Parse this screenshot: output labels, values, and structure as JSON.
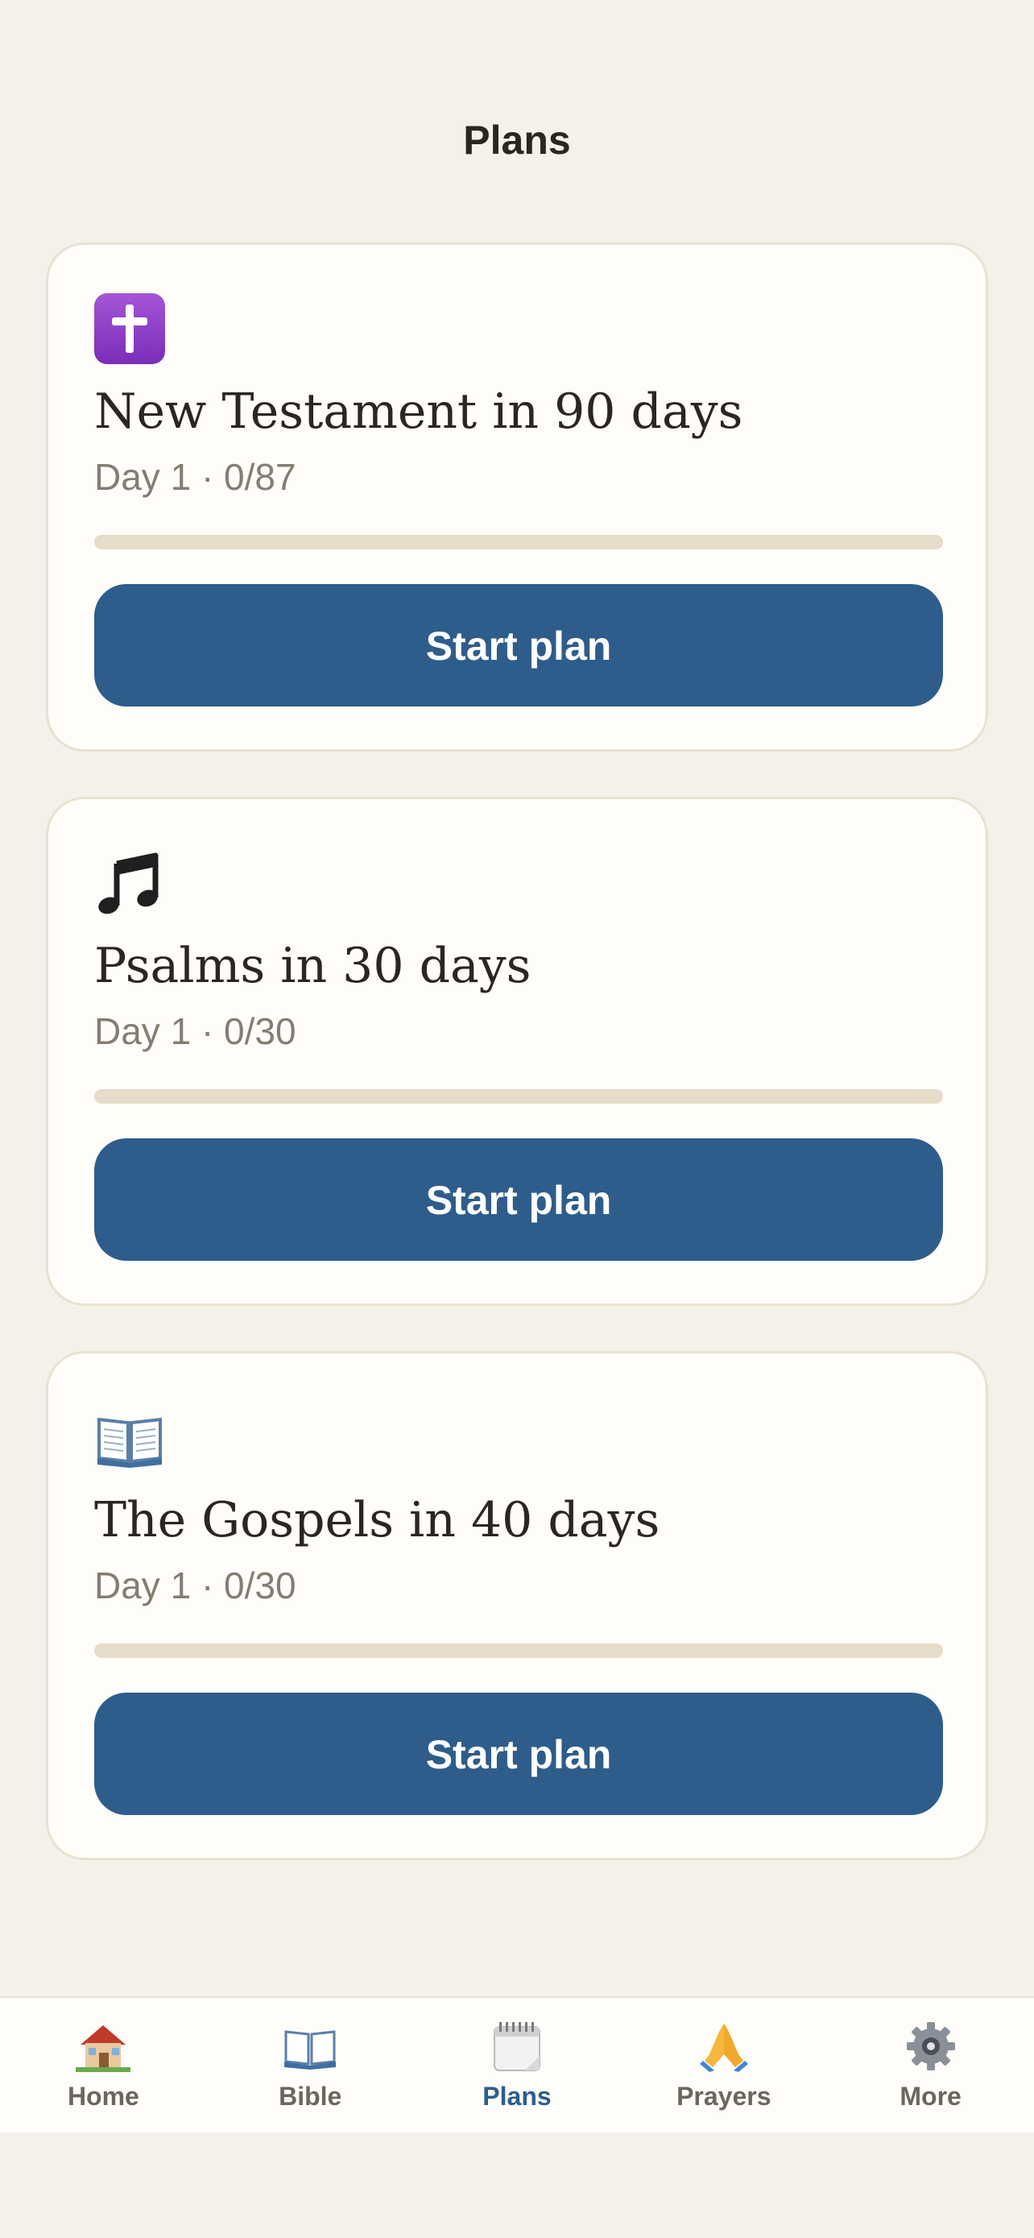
{
  "header": {
    "title": "Plans"
  },
  "plans": [
    {
      "icon": "latin-cross-icon",
      "title": "New Testament in 90 days",
      "meta": "Day 1 · 0/87",
      "progress": 0,
      "button": "Start plan"
    },
    {
      "icon": "music-notes-icon",
      "title": "Psalms in 30 days",
      "meta": "Day 1 · 0/30",
      "progress": 0,
      "button": "Start plan"
    },
    {
      "icon": "open-book-icon",
      "title": "The Gospels in 40 days",
      "meta": "Day 1 · 0/30",
      "progress": 0,
      "button": "Start plan"
    }
  ],
  "tabbar": {
    "active": "Plans",
    "items": [
      {
        "label": "Home",
        "icon": "house-icon"
      },
      {
        "label": "Bible",
        "icon": "open-book-icon"
      },
      {
        "label": "Plans",
        "icon": "calendar-icon"
      },
      {
        "label": "Prayers",
        "icon": "praying-hands-icon"
      },
      {
        "label": "More",
        "icon": "gear-icon"
      }
    ]
  },
  "colors": {
    "accent": "#2e5d8b",
    "background": "#f4f1ea",
    "card": "#fefdf9",
    "track": "#e6dcc9"
  }
}
